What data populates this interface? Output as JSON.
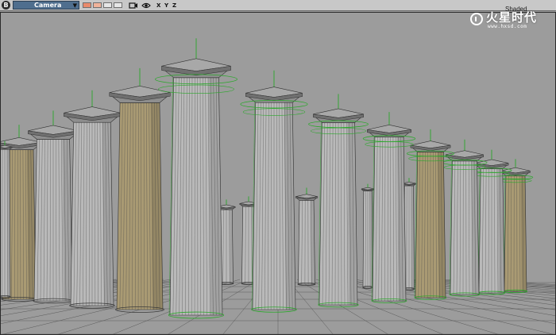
{
  "toolbar": {
    "badge": "B",
    "camera": "Camera",
    "axes": [
      "X",
      "Y",
      "Z"
    ],
    "shading_mode": "Shaded"
  },
  "logo": {
    "brand_cn": "火星时代",
    "url": "www.hxsd.com"
  },
  "scene": {
    "type": "3d-viewport",
    "subject": "doric-columns",
    "colors": {
      "background": "#9c9c9c",
      "column_gray": "#b9b9b9",
      "column_tan": "#a99a73",
      "selection_green": "#2ba82b",
      "wire": "#303030"
    }
  }
}
